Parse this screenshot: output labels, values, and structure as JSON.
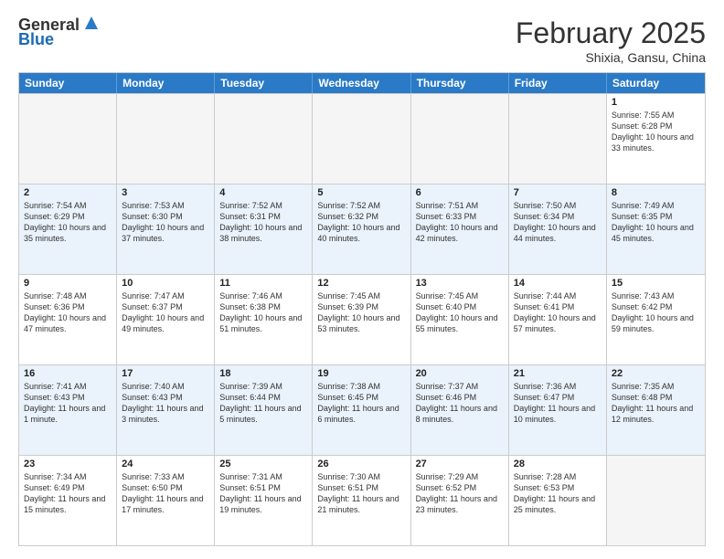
{
  "header": {
    "logo_line1": "General",
    "logo_line2": "Blue",
    "month": "February 2025",
    "location": "Shixia, Gansu, China"
  },
  "days_of_week": [
    "Sunday",
    "Monday",
    "Tuesday",
    "Wednesday",
    "Thursday",
    "Friday",
    "Saturday"
  ],
  "weeks": [
    [
      {
        "day": "",
        "info": ""
      },
      {
        "day": "",
        "info": ""
      },
      {
        "day": "",
        "info": ""
      },
      {
        "day": "",
        "info": ""
      },
      {
        "day": "",
        "info": ""
      },
      {
        "day": "",
        "info": ""
      },
      {
        "day": "1",
        "info": "Sunrise: 7:55 AM\nSunset: 6:28 PM\nDaylight: 10 hours and 33 minutes."
      }
    ],
    [
      {
        "day": "2",
        "info": "Sunrise: 7:54 AM\nSunset: 6:29 PM\nDaylight: 10 hours and 35 minutes."
      },
      {
        "day": "3",
        "info": "Sunrise: 7:53 AM\nSunset: 6:30 PM\nDaylight: 10 hours and 37 minutes."
      },
      {
        "day": "4",
        "info": "Sunrise: 7:52 AM\nSunset: 6:31 PM\nDaylight: 10 hours and 38 minutes."
      },
      {
        "day": "5",
        "info": "Sunrise: 7:52 AM\nSunset: 6:32 PM\nDaylight: 10 hours and 40 minutes."
      },
      {
        "day": "6",
        "info": "Sunrise: 7:51 AM\nSunset: 6:33 PM\nDaylight: 10 hours and 42 minutes."
      },
      {
        "day": "7",
        "info": "Sunrise: 7:50 AM\nSunset: 6:34 PM\nDaylight: 10 hours and 44 minutes."
      },
      {
        "day": "8",
        "info": "Sunrise: 7:49 AM\nSunset: 6:35 PM\nDaylight: 10 hours and 45 minutes."
      }
    ],
    [
      {
        "day": "9",
        "info": "Sunrise: 7:48 AM\nSunset: 6:36 PM\nDaylight: 10 hours and 47 minutes."
      },
      {
        "day": "10",
        "info": "Sunrise: 7:47 AM\nSunset: 6:37 PM\nDaylight: 10 hours and 49 minutes."
      },
      {
        "day": "11",
        "info": "Sunrise: 7:46 AM\nSunset: 6:38 PM\nDaylight: 10 hours and 51 minutes."
      },
      {
        "day": "12",
        "info": "Sunrise: 7:45 AM\nSunset: 6:39 PM\nDaylight: 10 hours and 53 minutes."
      },
      {
        "day": "13",
        "info": "Sunrise: 7:45 AM\nSunset: 6:40 PM\nDaylight: 10 hours and 55 minutes."
      },
      {
        "day": "14",
        "info": "Sunrise: 7:44 AM\nSunset: 6:41 PM\nDaylight: 10 hours and 57 minutes."
      },
      {
        "day": "15",
        "info": "Sunrise: 7:43 AM\nSunset: 6:42 PM\nDaylight: 10 hours and 59 minutes."
      }
    ],
    [
      {
        "day": "16",
        "info": "Sunrise: 7:41 AM\nSunset: 6:43 PM\nDaylight: 11 hours and 1 minute."
      },
      {
        "day": "17",
        "info": "Sunrise: 7:40 AM\nSunset: 6:43 PM\nDaylight: 11 hours and 3 minutes."
      },
      {
        "day": "18",
        "info": "Sunrise: 7:39 AM\nSunset: 6:44 PM\nDaylight: 11 hours and 5 minutes."
      },
      {
        "day": "19",
        "info": "Sunrise: 7:38 AM\nSunset: 6:45 PM\nDaylight: 11 hours and 6 minutes."
      },
      {
        "day": "20",
        "info": "Sunrise: 7:37 AM\nSunset: 6:46 PM\nDaylight: 11 hours and 8 minutes."
      },
      {
        "day": "21",
        "info": "Sunrise: 7:36 AM\nSunset: 6:47 PM\nDaylight: 11 hours and 10 minutes."
      },
      {
        "day": "22",
        "info": "Sunrise: 7:35 AM\nSunset: 6:48 PM\nDaylight: 11 hours and 12 minutes."
      }
    ],
    [
      {
        "day": "23",
        "info": "Sunrise: 7:34 AM\nSunset: 6:49 PM\nDaylight: 11 hours and 15 minutes."
      },
      {
        "day": "24",
        "info": "Sunrise: 7:33 AM\nSunset: 6:50 PM\nDaylight: 11 hours and 17 minutes."
      },
      {
        "day": "25",
        "info": "Sunrise: 7:31 AM\nSunset: 6:51 PM\nDaylight: 11 hours and 19 minutes."
      },
      {
        "day": "26",
        "info": "Sunrise: 7:30 AM\nSunset: 6:51 PM\nDaylight: 11 hours and 21 minutes."
      },
      {
        "day": "27",
        "info": "Sunrise: 7:29 AM\nSunset: 6:52 PM\nDaylight: 11 hours and 23 minutes."
      },
      {
        "day": "28",
        "info": "Sunrise: 7:28 AM\nSunset: 6:53 PM\nDaylight: 11 hours and 25 minutes."
      },
      {
        "day": "",
        "info": ""
      }
    ]
  ]
}
